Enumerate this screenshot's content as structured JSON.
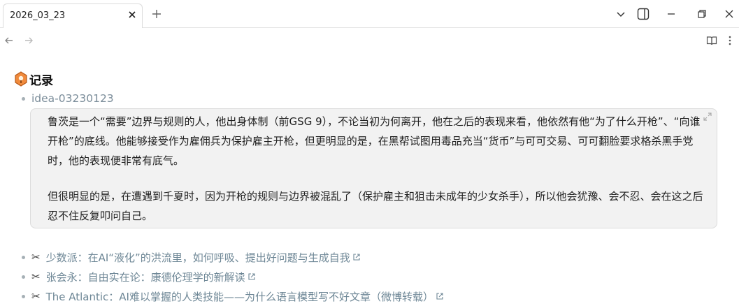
{
  "tab": {
    "title": "2026_03_23"
  },
  "page": {
    "heading": "记录",
    "idea_label": "idea-03230123",
    "quote": {
      "paragraph1": "鲁茨是一个“需要”边界与规则的人，他出身体制（前GSG 9），不论当初为何离开，他在之后的表现来看，他依然有他“为了什么开枪”、“向谁开枪”的底线。他能够接受作为雇佣兵为保护雇主开枪，但更明显的是，在黑帮试图用毒品充当“货币”与可可交易、可可翻脸要求格杀黑手党时，他的表现便非常有底气。",
      "paragraph2": "但很明显的是，在遭遇到千夏时，因为开枪的规则与边界被混乱了（保护雇主和狙击未成年的少女杀手），所以他会犹豫、会不忍、会在这之后忍不住反复叩问自己。"
    },
    "links": [
      {
        "prefix_icon": "scissors-icon",
        "text": "少数派：在AI“液化”的洪流里，如何呼吸、提出好问题与生成自我"
      },
      {
        "prefix_icon": "scissors-icon",
        "text": "张会永：自由实在论：康德伦理学的新解读"
      },
      {
        "prefix_icon": "scissors-icon",
        "text": "The Atlantic：AI难以掌握的人类技能——为什么语言模型写不好文章（微博转载）"
      }
    ]
  },
  "colors": {
    "link": "#6e8796",
    "bullet": "#a6b0b6",
    "quote_bg": "#f2f2f2"
  }
}
